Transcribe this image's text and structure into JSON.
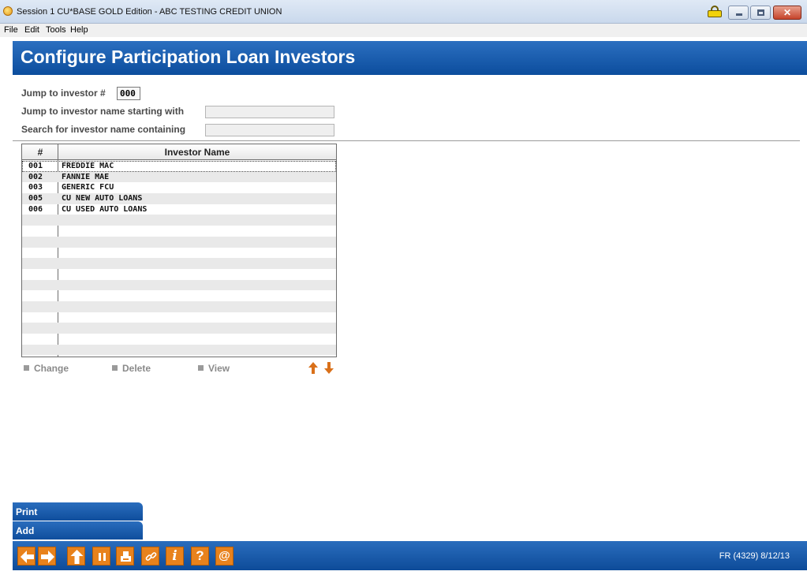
{
  "window": {
    "title": "Session 1 CU*BASE GOLD Edition - ABC TESTING CREDIT UNION"
  },
  "menu": [
    "File",
    "Edit",
    "Tools",
    "Help"
  ],
  "page": {
    "title": "Configure Participation Loan Investors"
  },
  "jump": {
    "investor_label": "Jump to investor #",
    "investor_value": "000",
    "name_starting_label": "Jump to investor name starting with",
    "name_starting_value": "",
    "name_containing_label": "Search for investor name containing",
    "name_containing_value": ""
  },
  "grid": {
    "headers": [
      "#",
      "Investor Name"
    ],
    "rows": [
      {
        "num": "001",
        "name": "FREDDIE MAC"
      },
      {
        "num": "002",
        "name": "FANNIE MAE"
      },
      {
        "num": "003",
        "name": "GENERIC FCU"
      },
      {
        "num": "005",
        "name": "CU NEW AUTO LOANS"
      },
      {
        "num": "006",
        "name": "CU USED AUTO LOANS"
      }
    ]
  },
  "actions": [
    "Change",
    "Delete",
    "View"
  ],
  "side_buttons": [
    "Print",
    "Add"
  ],
  "status": "FR (4329) 8/12/13",
  "colors": {
    "banner": "#0c4d9d",
    "toolbar_button": "#e8821c",
    "scroll_arrow": "#d9701a"
  }
}
